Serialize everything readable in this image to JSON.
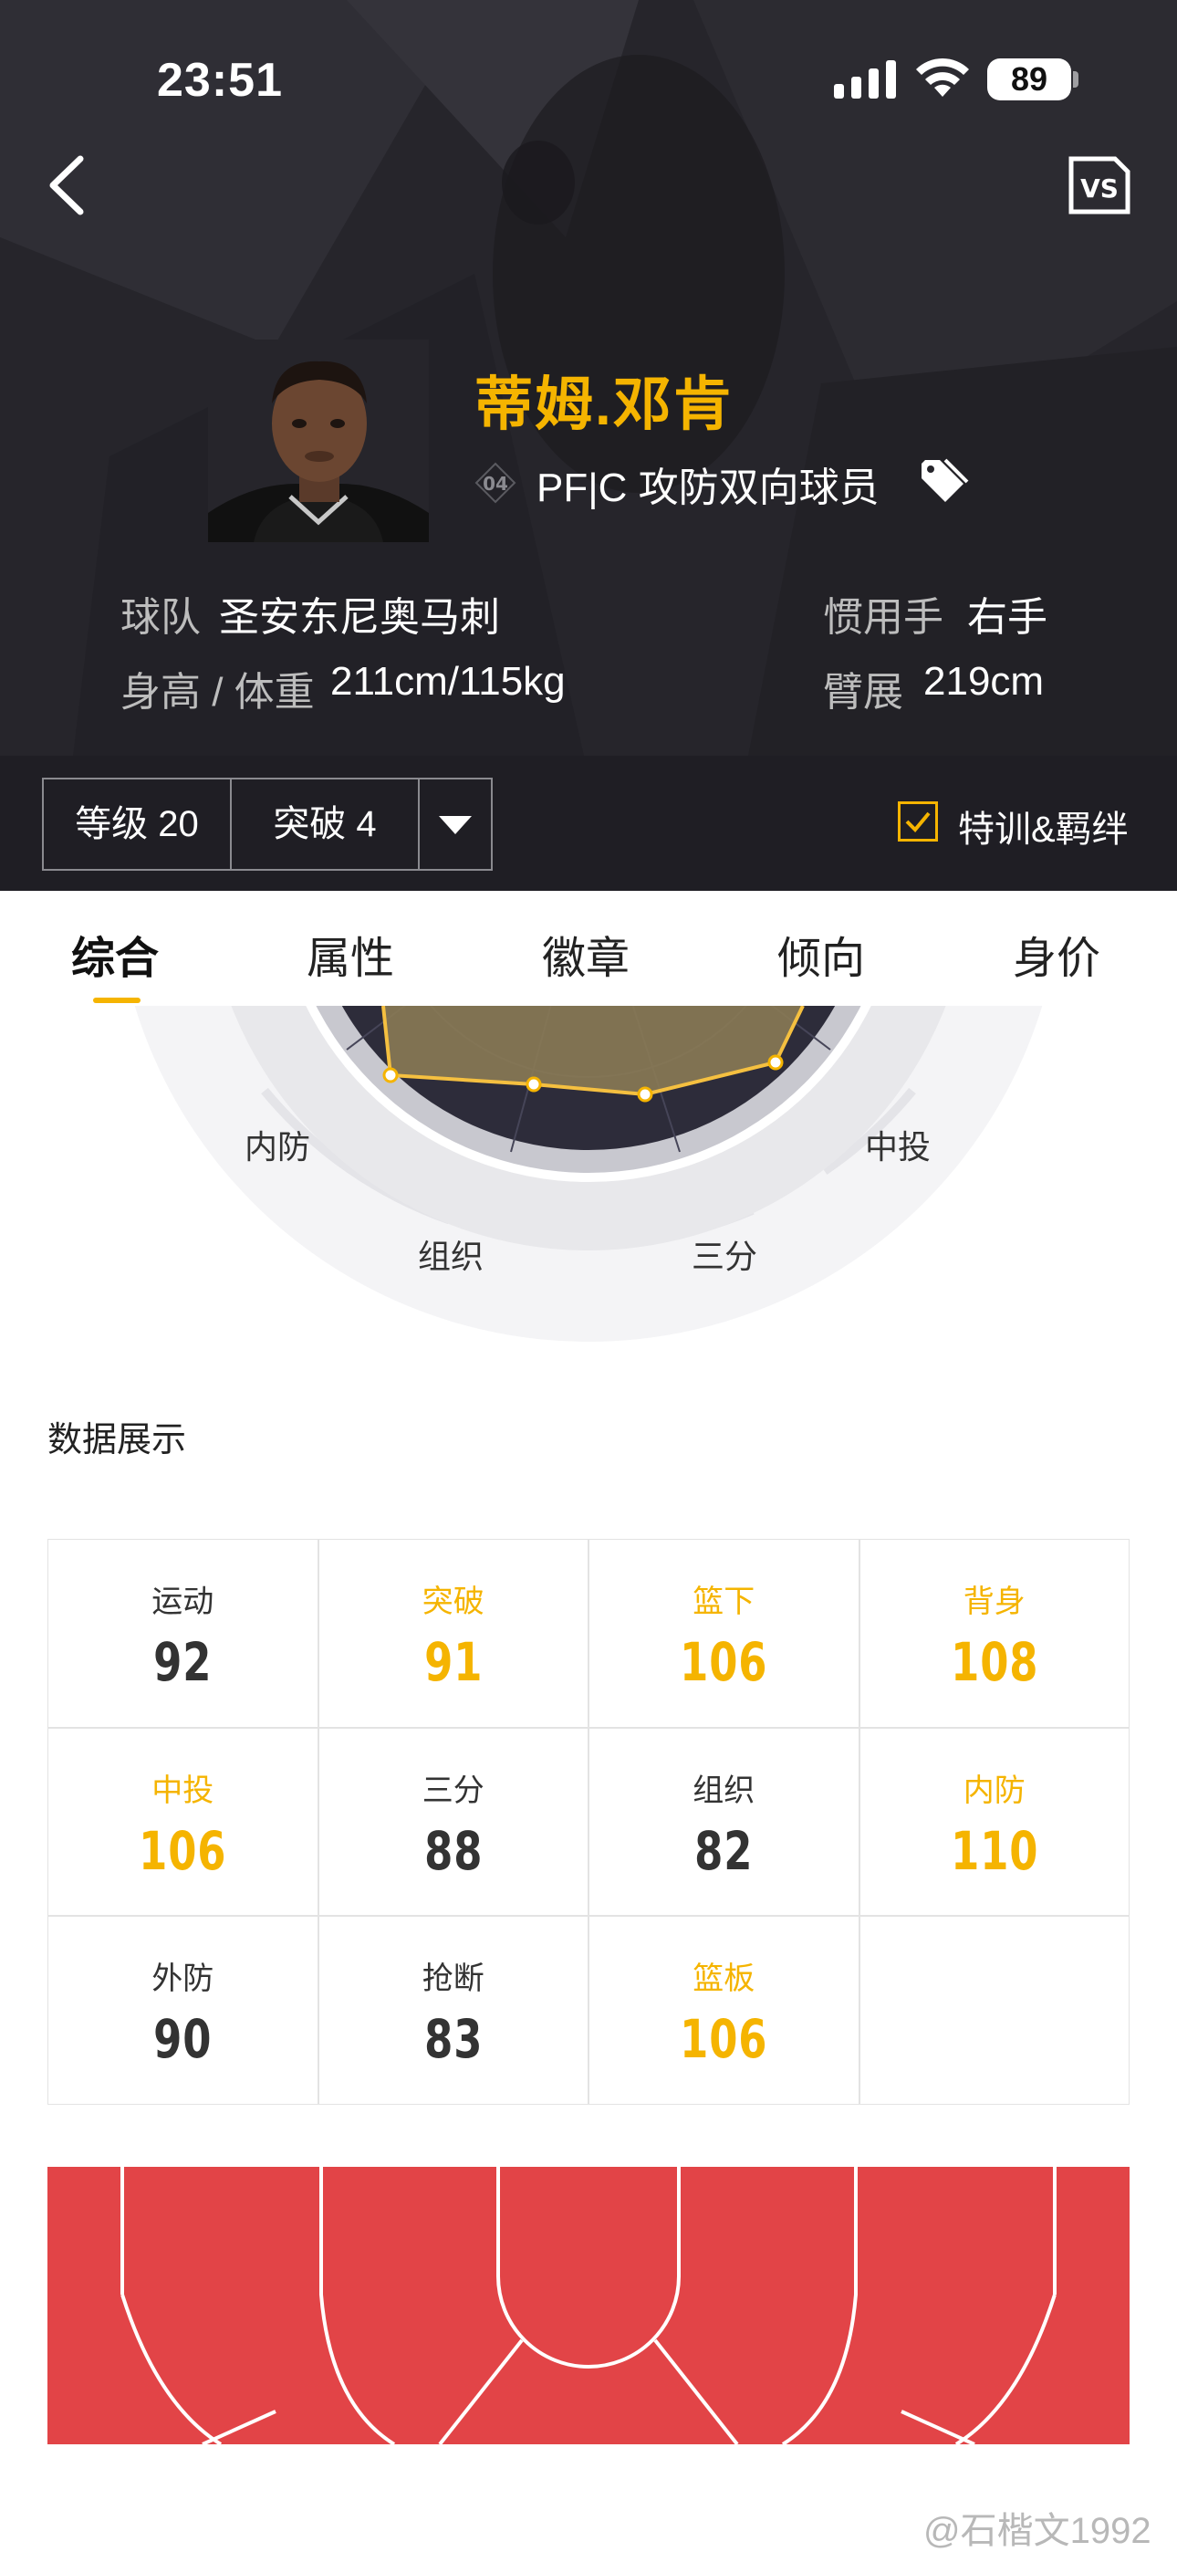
{
  "status_bar": {
    "time": "23:51",
    "battery": "89"
  },
  "player": {
    "name": "蒂姆.邓肯",
    "jersey_number": "04",
    "positions": "PF|C 攻防双向球员"
  },
  "info": {
    "team_label": "球队",
    "team_value": "圣安东尼奥马刺",
    "hand_label": "惯用手",
    "hand_value": "右手",
    "height_weight_label": "身高 / 体重",
    "height_weight_value": "211cm/115kg",
    "wingspan_label": "臂展",
    "wingspan_value": "219cm"
  },
  "level_bar": {
    "level": "等级 20",
    "breakthrough": "突破 4",
    "checkbox_label": "特训&羁绊",
    "checkbox_checked": true
  },
  "tabs": [
    "综合",
    "属性",
    "徽章",
    "倾向",
    "身价"
  ],
  "active_tab": 0,
  "radar": {
    "labels": {
      "inside_def": "内防",
      "mid": "中投",
      "playmaking": "组织",
      "three": "三分"
    }
  },
  "stats_section_title": "数据展示",
  "stats": [
    {
      "label": "运动",
      "value": "92",
      "highlight": false
    },
    {
      "label": "突破",
      "value": "91",
      "highlight": true
    },
    {
      "label": "篮下",
      "value": "106",
      "highlight": true
    },
    {
      "label": "背身",
      "value": "108",
      "highlight": true
    },
    {
      "label": "中投",
      "value": "106",
      "highlight": true
    },
    {
      "label": "三分",
      "value": "88",
      "highlight": false
    },
    {
      "label": "组织",
      "value": "82",
      "highlight": false
    },
    {
      "label": "内防",
      "value": "110",
      "highlight": true
    },
    {
      "label": "外防",
      "value": "90",
      "highlight": false
    },
    {
      "label": "抢断",
      "value": "83",
      "highlight": false
    },
    {
      "label": "篮板",
      "value": "106",
      "highlight": true
    }
  ],
  "colors": {
    "accent": "#f5b400",
    "header_bg": "#26252b",
    "court": "#e24447"
  },
  "watermark": "@石楷文1992"
}
